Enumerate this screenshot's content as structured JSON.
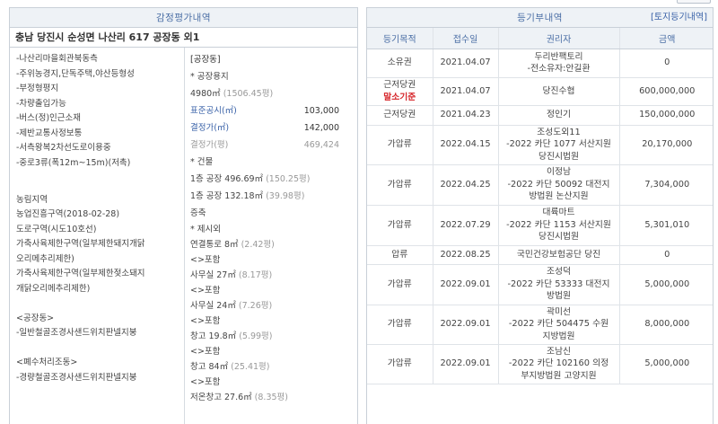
{
  "left": {
    "title": "감정평가내역",
    "address": "충남 당진시 순성면 나산리 617 공장동 외1",
    "col_a": [
      "-나산리마을회관북동측",
      "-주위농경지,단독주택,야산등형성",
      "-부정형평지",
      "-차량출입가능",
      "-버스(정)인근소재",
      "-제반교통사정보통",
      "-서측왕복2차선도로이용중",
      "-중로3류(폭12m~15m)(저촉)",
      "",
      "농림지역",
      "농업진흥구역(2018-02-28)",
      "도로구역(시도10호선)",
      "가축사육제한구역(일부제한돼지개닭",
      "오리메추리제한)",
      "가축사육제한구역(일부제한젖소돼지",
      "개닭오리메추리제한)",
      "",
      "<공장동>",
      "-일반철골조경사샌드위치판넬지붕",
      "",
      "<폐수처리조동>",
      "-경량철골조경사샌드위치판넬지붕"
    ],
    "col_b": {
      "section1": "[공장동]",
      "land_label": "* 공장용지",
      "land_area": "4980㎡",
      "land_area_py": "(1506.45평)",
      "public_price_label": "표준공시(㎡)",
      "public_price": "103,000",
      "decided_price_label": "결정가(㎡)",
      "decided_price": "142,000",
      "decided_py_label": "결정가(평)",
      "decided_py": "469,424",
      "building_label": "* 건물",
      "building1": "1층 공장 496.69㎡",
      "building1_py": "(150.25평)",
      "building2": "1층 공장 132.18㎡",
      "building2_py": "(39.98평)",
      "extra_label": "증축",
      "exclude_label": "* 제시외",
      "ex1": "연결통로 8㎡",
      "ex1_py": "(2.42평)",
      "ex2_tag": "<>포함",
      "ex2": "사무실 27㎡",
      "ex2_py": "(8.17평)",
      "ex3_tag": "<>포함",
      "ex3": "사무실 24㎡",
      "ex3_py": "(7.26평)",
      "ex4_tag": "<>포함",
      "ex4": "창고 19.8㎡",
      "ex4_py": "(5.99평)",
      "ex5_tag": "<>포함",
      "ex5": "창고 84㎡",
      "ex5_py": "(25.41평)",
      "ex6_tag": "<>포함",
      "ex6": "저온창고 27.6㎡",
      "ex6_py": "(8.35평)"
    }
  },
  "right": {
    "title": "등기부내역",
    "link": "[토지등기내역]",
    "headers": [
      "등기목적",
      "접수일",
      "권리자",
      "금액"
    ],
    "rows": [
      {
        "purpose": "소유권",
        "warn": "",
        "date": "2021.04.07",
        "holder": [
          "두리반팩토리",
          "-전소유자:안길환"
        ],
        "amount": "0"
      },
      {
        "purpose": "근저당권",
        "warn": "말소기준",
        "date": "2021.04.07",
        "holder": [
          "당진수협"
        ],
        "amount": "600,000,000"
      },
      {
        "purpose": "근저당권",
        "warn": "",
        "date": "2021.04.23",
        "holder": [
          "정인기"
        ],
        "amount": "150,000,000"
      },
      {
        "purpose": "가압류",
        "warn": "",
        "date": "2022.04.15",
        "holder": [
          "조성도외11",
          "-2022 카단 1077 서산지원",
          "당진시법원"
        ],
        "amount": "20,170,000"
      },
      {
        "purpose": "가압류",
        "warn": "",
        "date": "2022.04.25",
        "holder": [
          "이정남",
          "-2022 카단 50092 대전지",
          "방법원 논산지원"
        ],
        "amount": "7,304,000"
      },
      {
        "purpose": "가압류",
        "warn": "",
        "date": "2022.07.29",
        "holder": [
          "대륙마트",
          "-2022 카단 1153 서산지원",
          "당진시법원"
        ],
        "amount": "5,301,010"
      },
      {
        "purpose": "압류",
        "warn": "",
        "date": "2022.08.25",
        "holder": [
          "국민건강보험공단 당진"
        ],
        "amount": "0"
      },
      {
        "purpose": "가압류",
        "warn": "",
        "date": "2022.09.01",
        "holder": [
          "조성덕",
          "-2022 카단 53333 대전지",
          "방법원"
        ],
        "amount": "5,000,000"
      },
      {
        "purpose": "가압류",
        "warn": "",
        "date": "2022.09.01",
        "holder": [
          "곽미선",
          "-2022 카단 504475 수원",
          "지방법원"
        ],
        "amount": "8,000,000"
      },
      {
        "purpose": "가압류",
        "warn": "",
        "date": "2022.09.01",
        "holder": [
          "조남신",
          "-2022 카단 102160 의정",
          "부지방법원 고양지원"
        ],
        "amount": "5,000,000"
      }
    ]
  }
}
